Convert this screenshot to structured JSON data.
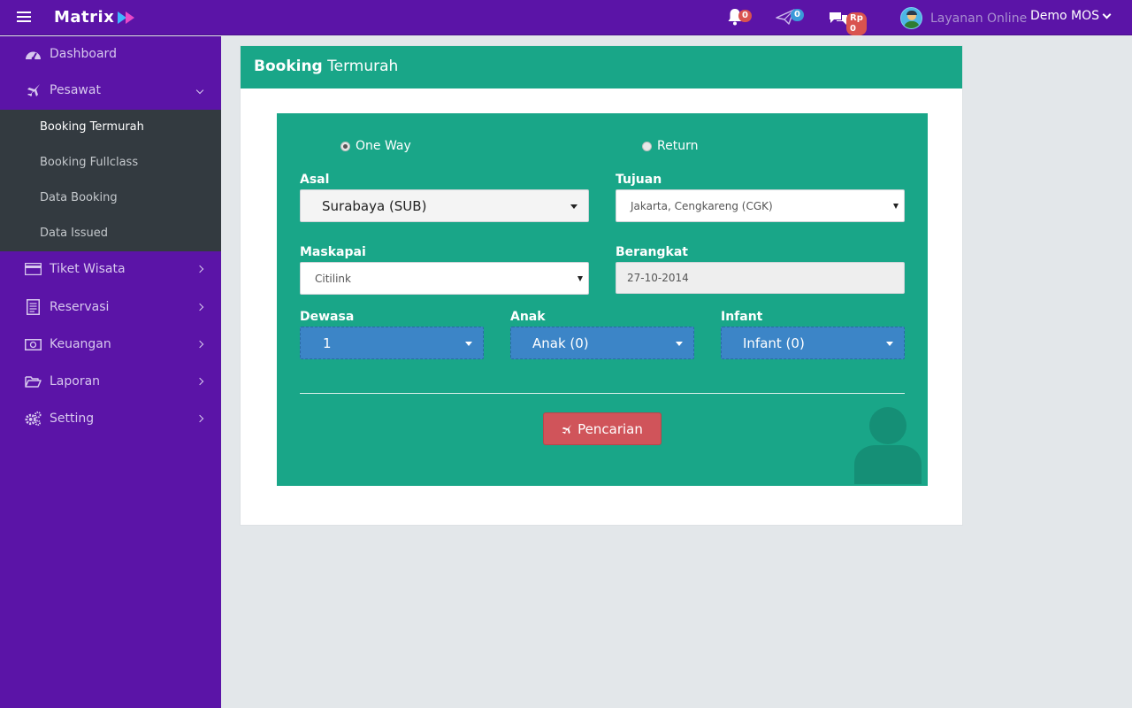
{
  "brand": {
    "name": "Matrix"
  },
  "topbar": {
    "notifications_count": "0",
    "messages_count": "0",
    "balance_label": "Rp 0",
    "online_label": "Layanan Online",
    "user_name": "Demo MOS"
  },
  "sidebar": {
    "items": [
      {
        "label": "Dashboard",
        "icon": "dashboard-icon"
      },
      {
        "label": "Pesawat",
        "icon": "plane-icon"
      },
      {
        "label": "Tiket Wisata",
        "icon": "card-icon"
      },
      {
        "label": "Reservasi",
        "icon": "document-icon"
      },
      {
        "label": "Keuangan",
        "icon": "money-icon"
      },
      {
        "label": "Laporan",
        "icon": "folder-icon"
      },
      {
        "label": "Setting",
        "icon": "gears-icon"
      }
    ],
    "pesawat_sub": [
      {
        "label": "Booking Termurah"
      },
      {
        "label": "Booking Fullclass"
      },
      {
        "label": "Data Booking"
      },
      {
        "label": "Data Issued"
      }
    ]
  },
  "panel": {
    "title_bold": "Booking",
    "title_rest": "Termurah"
  },
  "form": {
    "one_way": "One Way",
    "return": "Return",
    "asal_label": "Asal",
    "asal_value": "Surabaya (SUB)",
    "tujuan_label": "Tujuan",
    "tujuan_value": "Jakarta, Cengkareng (CGK)",
    "maskapai_label": "Maskapai",
    "maskapai_value": "Citilink",
    "berangkat_label": "Berangkat",
    "berangkat_value": "27-10-2014",
    "dewasa_label": "Dewasa",
    "dewasa_value": "1",
    "anak_label": "Anak",
    "anak_value": "Anak (0)",
    "infant_label": "Infant",
    "infant_value": "Infant (0)",
    "search_button": "Pencarian"
  },
  "colors": {
    "primary": "#5b14a7",
    "teal": "#19a688",
    "danger": "#d0545a",
    "blue_select": "#3c85c7",
    "submenu_bg": "#333a40"
  }
}
